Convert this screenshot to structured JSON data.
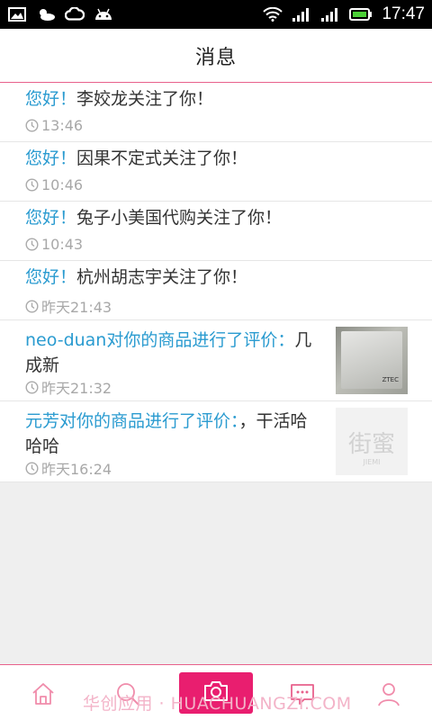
{
  "status_bar": {
    "time": "17:47",
    "icons_left": [
      "gallery-icon",
      "weather-icon",
      "cloud-icon",
      "android-icon"
    ],
    "icons_right": [
      "wifi-icon",
      "signal-icon",
      "signal-icon-2",
      "battery-icon"
    ]
  },
  "header": {
    "title": "消息"
  },
  "messages": [
    {
      "greeting": "您好！",
      "text": "李姣龙关注了你！",
      "time": "13:46"
    },
    {
      "greeting": "您好！",
      "text": "因果不定式关注了你！",
      "time": "10:46"
    },
    {
      "greeting": "您好！",
      "text": "兔子小美国代购关注了你！",
      "time": "10:43"
    },
    {
      "greeting": "您好！",
      "text": "杭州胡志宇关注了你！",
      "time": "昨天21:43"
    }
  ],
  "comments": [
    {
      "lead": "neo-duan对你的商品进行了评价：",
      "text": "几成新",
      "time": "昨天21:32",
      "thumb_label": "ZTEC"
    },
    {
      "lead": "元芳对你的商品进行了评价：",
      "text": "，干活哈哈哈",
      "time": "昨天16:24",
      "thumb_logo": "街蜜",
      "thumb_sub": "JIEMI"
    }
  ],
  "tabbar": {
    "tabs": [
      "home-icon",
      "search-icon",
      "camera-icon",
      "message-icon",
      "profile-icon"
    ],
    "watermark": "华创应用 · HUACHUANGZI.COM"
  },
  "colors": {
    "accent": "#e91e6f",
    "highlight": "#2a9bd0",
    "divider": "#e8618c"
  }
}
